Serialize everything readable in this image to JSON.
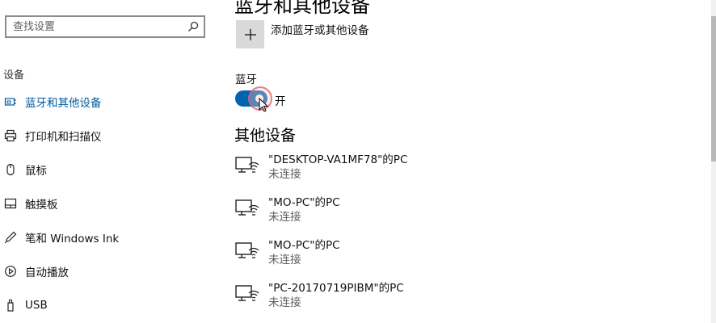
{
  "search": {
    "placeholder": "查找设置"
  },
  "sidebar": {
    "section_title": "设备",
    "items": [
      {
        "label": "蓝牙和其他设备",
        "icon": "bluetooth-devices-icon",
        "active": true
      },
      {
        "label": "打印机和扫描仪",
        "icon": "printer-icon"
      },
      {
        "label": "鼠标",
        "icon": "mouse-icon"
      },
      {
        "label": "触摸板",
        "icon": "touchpad-icon"
      },
      {
        "label": "笔和 Windows Ink",
        "icon": "pen-icon"
      },
      {
        "label": "自动播放",
        "icon": "autoplay-icon"
      },
      {
        "label": "USB",
        "icon": "usb-icon"
      }
    ]
  },
  "main": {
    "page_title": "蓝牙和其他设备",
    "add_device_label": "添加蓝牙或其他设备",
    "bluetooth_label": "蓝牙",
    "bluetooth_state": "开",
    "bluetooth_on": true,
    "other_devices_title": "其他设备",
    "devices": [
      {
        "name": "\"DESKTOP-VA1MF78\"的PC",
        "status": "未连接"
      },
      {
        "name": "\"MO-PC\"的PC",
        "status": "未连接"
      },
      {
        "name": "\"MO-PC\"的PC",
        "status": "未连接"
      },
      {
        "name": "\"PC-20170719PIBM\"的PC",
        "status": "未连接"
      }
    ]
  },
  "colors": {
    "accent": "#0063b1",
    "active_text": "#005a9e"
  }
}
